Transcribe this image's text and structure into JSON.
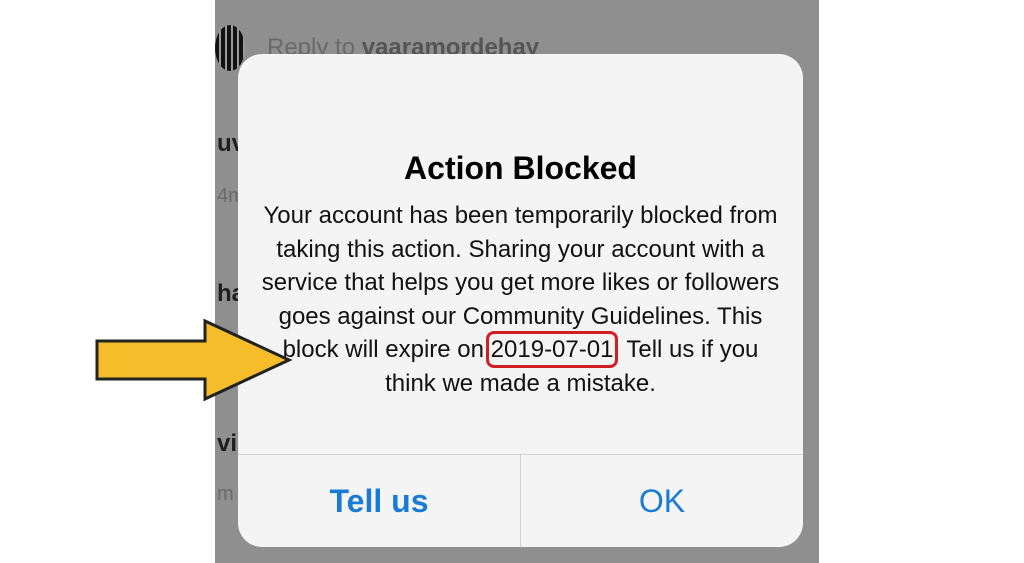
{
  "background": {
    "reply_prefix": "Reply to ",
    "reply_username": "vaaramordehay",
    "fragments": [
      "uv",
      "4m",
      "ha",
      "vi",
      "m"
    ]
  },
  "dialog": {
    "title": "Action Blocked",
    "message_before": "Your account has been temporarily blocked from taking this action. Sharing your account with a service that helps you get more likes or followers goes against our Community Guidelines. This block will expire on ",
    "expire_date": "2019-07-01",
    "message_after": ". Tell us if you think we made a mistake."
  },
  "actions": {
    "tell_us": "Tell us",
    "ok": "OK"
  },
  "colors": {
    "accent": "#1a7bd6",
    "highlight": "#d21f26",
    "arrow_fill": "#f5bd2a"
  },
  "icons": {
    "arrow": "right-arrow-icon"
  }
}
